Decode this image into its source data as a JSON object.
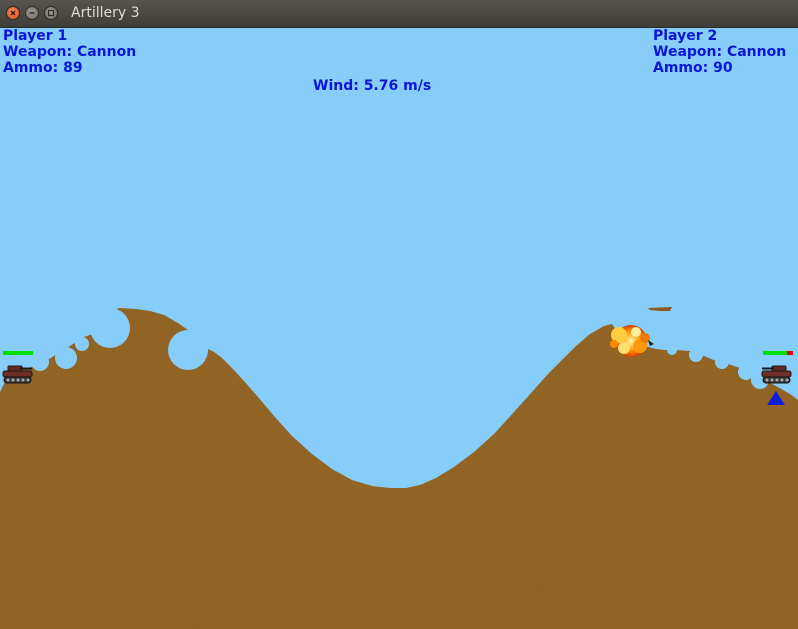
{
  "window": {
    "title": "Artillery 3"
  },
  "player1": {
    "name": "Player 1",
    "weapon": "Weapon: Cannon",
    "ammo": "Ammo: 89",
    "health_fraction": 1.0
  },
  "player2": {
    "name": "Player 2",
    "weapon": "Weapon: Cannon",
    "ammo": "Ammo: 90",
    "health_fraction": 0.8,
    "active_turn": true
  },
  "wind": {
    "text": "Wind: 5.76 m/s"
  },
  "colors": {
    "sky": "#87cdf9",
    "ground": "#8b5a1c",
    "hud_text": "#0a16d6",
    "health_good": "#00e000",
    "health_lost": "#e00000",
    "turn_marker": "#0b20d8"
  }
}
